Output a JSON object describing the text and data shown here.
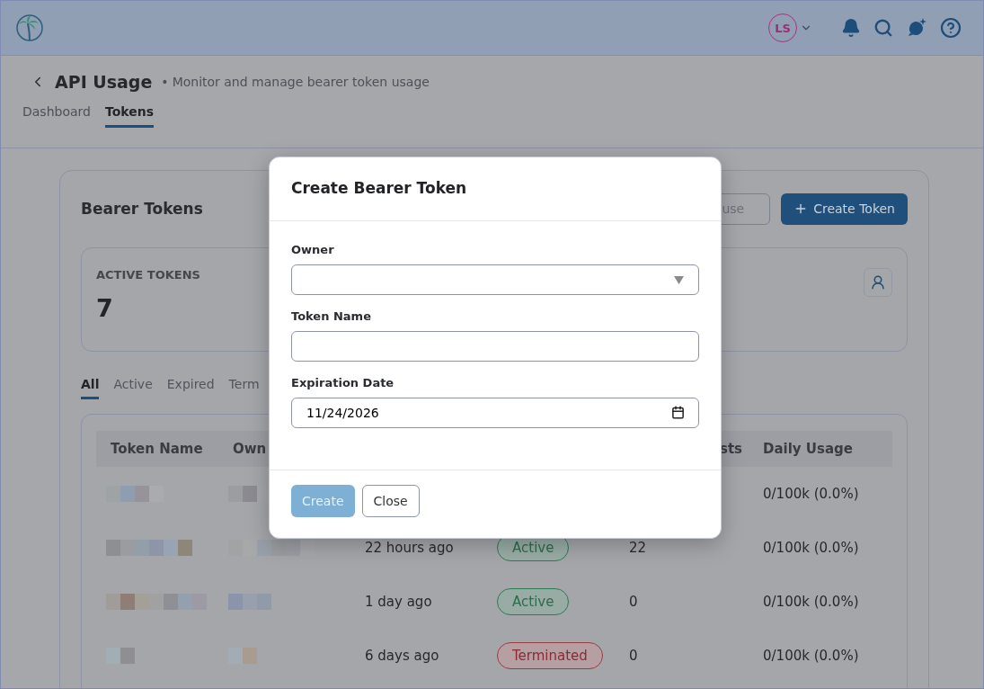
{
  "topbar": {
    "avatar_initials": "LS"
  },
  "page": {
    "title": "API Usage",
    "separator": "•",
    "subtitle": "Monitor and manage bearer token usage",
    "tabs": [
      {
        "label": "Dashboard",
        "selected": false
      },
      {
        "label": "Tokens",
        "selected": true
      }
    ]
  },
  "card": {
    "title": "Bearer Tokens",
    "actions": [
      {
        "label": "use",
        "kind": "outline"
      },
      {
        "label": "Create Token",
        "kind": "primary"
      }
    ],
    "stat": {
      "label": "ACTIVE TOKENS",
      "value": "7"
    },
    "filters": [
      {
        "label": "All",
        "selected": true
      },
      {
        "label": "Active",
        "selected": false
      },
      {
        "label": "Expired",
        "selected": false
      },
      {
        "label": "Term",
        "selected": false
      }
    ],
    "table": {
      "columns": [
        "Token Name",
        "Own",
        "sts",
        "Daily Usage"
      ],
      "rows": [
        {
          "daily_usage": "0/100k (0.0%)"
        },
        {
          "last_used": "22 hours ago",
          "status": {
            "label": "Active",
            "kind": "active"
          },
          "requests": "22",
          "daily_usage": "0/100k (0.0%)"
        },
        {
          "last_used": "1 day ago",
          "status": {
            "label": "Active",
            "kind": "active"
          },
          "requests": "0",
          "daily_usage": "0/100k (0.0%)"
        },
        {
          "last_used": "6 days ago",
          "status": {
            "label": "Terminated",
            "kind": "terminated"
          },
          "requests": "0",
          "daily_usage": "0/100k (0.0%)"
        }
      ]
    }
  },
  "dialog": {
    "title": "Create Bearer Token",
    "fields": [
      {
        "label": "Owner",
        "kind": "select"
      },
      {
        "label": "Token Name",
        "kind": "text"
      },
      {
        "label": "Expiration Date",
        "kind": "date",
        "value": "11/24/2026"
      }
    ],
    "buttons": [
      {
        "label": "Create",
        "kind": "primary",
        "disabled": true
      },
      {
        "label": "Close",
        "kind": "secondary",
        "disabled": false
      }
    ]
  }
}
